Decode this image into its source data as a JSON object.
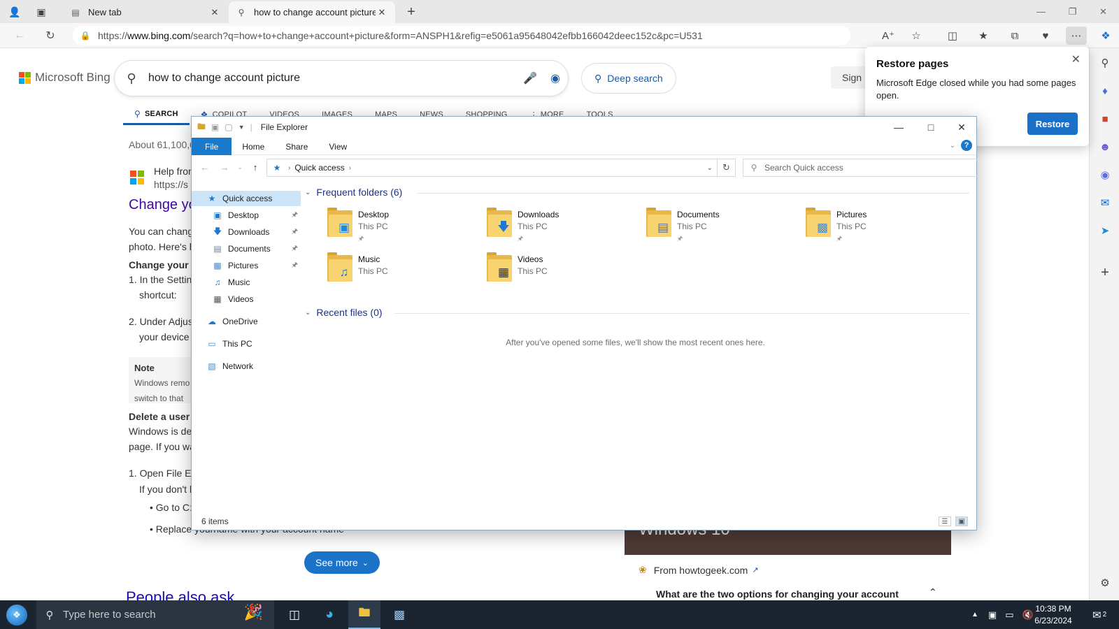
{
  "browser": {
    "tabs": [
      {
        "title": "New tab"
      },
      {
        "title": "how to change account picture -"
      }
    ],
    "url_prefix": "https://",
    "url_host": "www.bing.com",
    "url_rest": "/search?q=how+to+change+account+picture&form=ANSPH1&refig=e5061a95648042efbb166042deec152c&pc=U531"
  },
  "bing": {
    "logo_text": "Microsoft Bing",
    "query": "how to change account picture",
    "deep_search": "Deep search",
    "sign_in": "Sign",
    "scopes": [
      "SEARCH",
      "COPILOT",
      "VIDEOS",
      "IMAGES",
      "MAPS",
      "NEWS",
      "SHOPPING",
      "MORE",
      "TOOLS"
    ],
    "result_count": "About 61,100,0",
    "source_name": "Help fron",
    "source_url": "https://s",
    "result_title": "Change yo",
    "lines": [
      "You can chang",
      "photo. Here's h",
      "Change your u",
      "1. In the Settin",
      "shortcut:",
      "2. Under Adjus",
      "your device",
      "Note",
      "Windows remo",
      "switch to that",
      "Delete a user a",
      "Windows is de",
      "page. If you wa",
      "1. Open File Ex",
      "If you don't l",
      "• Go to C:\\",
      "• Replace yourname with your account name"
    ],
    "see_more": "See more",
    "people_also_ask": "People also ask",
    "image_card_text": "Windows 10",
    "from_source": "From howtogeek.com",
    "faq_question": "What are the two options for changing your account"
  },
  "restore_popup": {
    "title": "Restore pages",
    "body": "Microsoft Edge closed while you had some pages open.",
    "button": "Restore"
  },
  "explorer": {
    "title": "File Explorer",
    "ribbon_tabs": [
      "File",
      "Home",
      "Share",
      "View"
    ],
    "path": "Quick access",
    "search_placeholder": "Search Quick access",
    "nav_items": [
      {
        "label": "Quick access",
        "icon": "star-icon"
      },
      {
        "label": "Desktop",
        "icon": "desktop-icon",
        "pinned": true
      },
      {
        "label": "Downloads",
        "icon": "download-icon",
        "pinned": true
      },
      {
        "label": "Documents",
        "icon": "document-icon",
        "pinned": true
      },
      {
        "label": "Pictures",
        "icon": "picture-icon",
        "pinned": true
      },
      {
        "label": "Music",
        "icon": "music-icon"
      },
      {
        "label": "Videos",
        "icon": "video-icon"
      },
      {
        "label": "OneDrive",
        "icon": "cloud-icon"
      },
      {
        "label": "This PC",
        "icon": "computer-icon"
      },
      {
        "label": "Network",
        "icon": "network-icon"
      }
    ],
    "frequent_header": "Frequent folders (6)",
    "folders": [
      {
        "name": "Desktop",
        "location": "This PC",
        "pinned": true
      },
      {
        "name": "Downloads",
        "location": "This PC",
        "pinned": true
      },
      {
        "name": "Documents",
        "location": "This PC",
        "pinned": true
      },
      {
        "name": "Pictures",
        "location": "This PC",
        "pinned": true
      },
      {
        "name": "Music",
        "location": "This PC",
        "pinned": false
      },
      {
        "name": "Videos",
        "location": "This PC",
        "pinned": false
      }
    ],
    "recent_header": "Recent files (0)",
    "recent_empty": "After you've opened some files, we'll show the most recent ones here.",
    "status_count": "6 items"
  },
  "taskbar": {
    "search_placeholder": "Type here to search",
    "time": "10:38 PM",
    "date": "6/23/2024",
    "notification_count": "2"
  },
  "colors": {
    "accent": "#1979ca",
    "bing_link": "#4007a2",
    "taskbar": "#1a2531"
  }
}
